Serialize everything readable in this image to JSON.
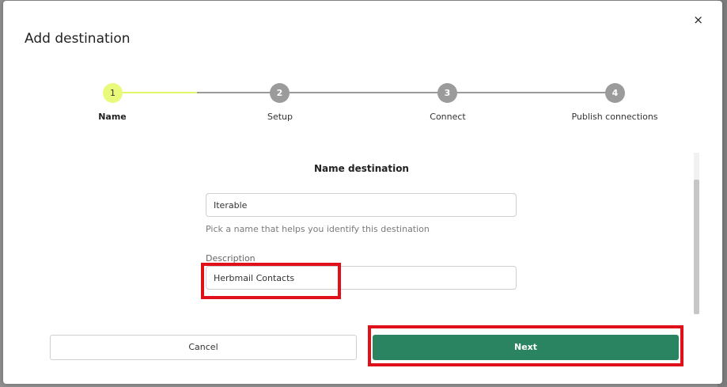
{
  "modal": {
    "title": "Add destination",
    "close_glyph": "×"
  },
  "stepper": {
    "steps": [
      {
        "number": "1",
        "label": "Name",
        "active": true
      },
      {
        "number": "2",
        "label": "Setup",
        "active": false
      },
      {
        "number": "3",
        "label": "Connect",
        "active": false
      },
      {
        "number": "4",
        "label": "Publish connections",
        "active": false
      }
    ]
  },
  "form": {
    "section_title": "Name destination",
    "name_value": "Iterable",
    "name_helper": "Pick a name that helps you identify this destination",
    "description_label": "Description",
    "description_value": "Herbmail Contacts"
  },
  "footer": {
    "cancel_label": "Cancel",
    "next_label": "Next"
  },
  "colors": {
    "active_step": "#e9fa7a",
    "inactive_step": "#9b9b9b",
    "primary_button": "#2a8461",
    "highlight": "#e0101a"
  }
}
